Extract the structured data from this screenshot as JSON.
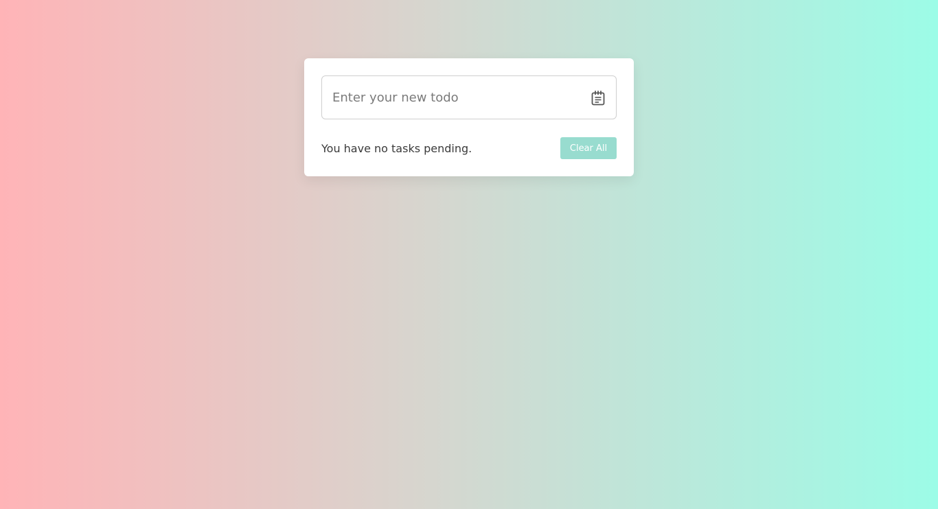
{
  "todo_input": {
    "placeholder": "Enter your new todo",
    "value": "",
    "icon": "calendar-icon"
  },
  "status": {
    "pending_text": "You have no tasks pending."
  },
  "actions": {
    "clear_all_label": "Clear All"
  },
  "colors": {
    "background_start": "#ffb4b7",
    "background_end": "#9cfce7",
    "accent": "#98dccf",
    "card": "#ffffff"
  }
}
